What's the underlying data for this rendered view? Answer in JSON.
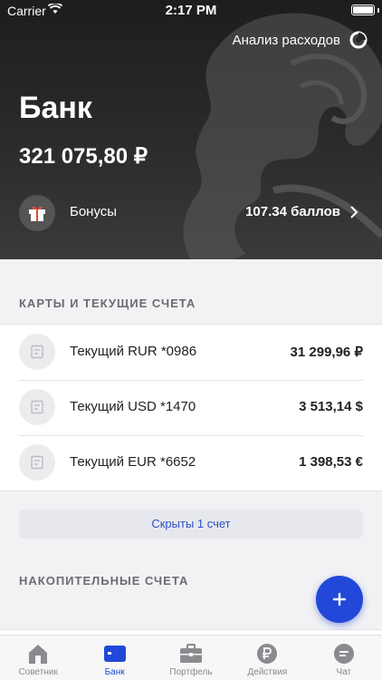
{
  "status_bar": {
    "carrier": "Carrier",
    "time": "2:17 PM"
  },
  "header": {
    "analysis_label": "Анализ расходов",
    "title": "Банк",
    "total": "321 075,80 ₽",
    "bonus": {
      "label": "Бонусы",
      "points": "107.34 баллов"
    }
  },
  "cards_section": {
    "title": "КАРТЫ И ТЕКУЩИЕ СЧЕТА",
    "accounts": [
      {
        "name": "Текущий RUR *0986",
        "amount": "31 299,96 ₽"
      },
      {
        "name": "Текущий USD *1470",
        "amount": "3 513,14 $"
      },
      {
        "name": "Текущий EUR *6652",
        "amount": "1 398,53 €"
      }
    ],
    "hidden_label": "Скрыты 1 счет"
  },
  "savings_section": {
    "title": "НАКОПИТЕЛЬНЫЕ СЧЕТА"
  },
  "fab_icon": "plus-icon",
  "tabbar": {
    "items": [
      {
        "label": "Советник",
        "icon": "home-icon"
      },
      {
        "label": "Банк",
        "icon": "card-icon",
        "active": true
      },
      {
        "label": "Портфель",
        "icon": "briefcase-icon"
      },
      {
        "label": "Действия",
        "icon": "ruble-icon"
      },
      {
        "label": "Чат",
        "icon": "chat-icon"
      }
    ]
  },
  "colors": {
    "accent": "#2148d8",
    "header_bg": "#262626",
    "background": "#f2f2f4"
  }
}
